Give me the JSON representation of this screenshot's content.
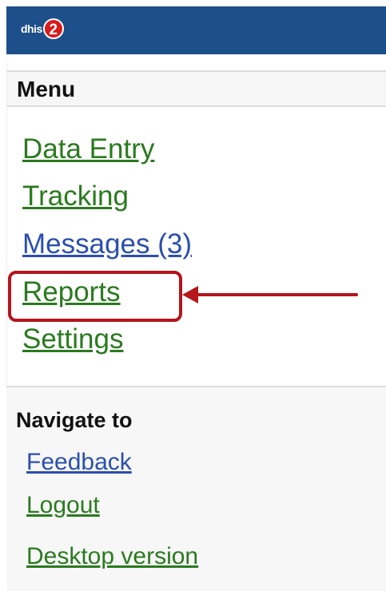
{
  "header": {
    "logo_text": "dhis",
    "logo_badge": "2",
    "color": "#1d4f8a"
  },
  "menu": {
    "heading": "Menu",
    "items": [
      {
        "label": "Data Entry",
        "color": "#2a7a1e"
      },
      {
        "label": "Tracking",
        "color": "#2a7a1e"
      },
      {
        "label": "Messages (3)",
        "color": "#2b4fae"
      },
      {
        "label": "Reports",
        "color": "#2a7a1e",
        "highlighted": true
      },
      {
        "label": "Settings",
        "color": "#2a7a1e"
      }
    ]
  },
  "annotation": {
    "color": "#b5151b"
  },
  "navigate": {
    "heading": "Navigate to",
    "links": [
      {
        "label": "Feedback",
        "color": "#2b4fae"
      },
      {
        "label": "Logout",
        "color": "#2a7a1e"
      },
      {
        "label": "Desktop version",
        "color": "#2a7a1e"
      }
    ]
  }
}
